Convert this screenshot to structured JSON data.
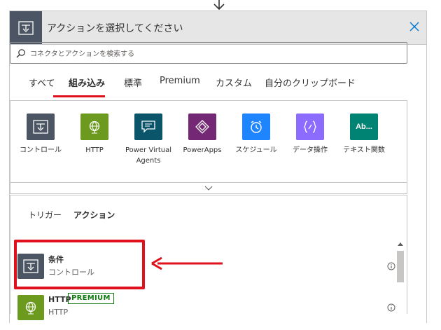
{
  "header": {
    "title": "アクションを選択してください"
  },
  "search": {
    "placeholder": "コネクタとアクションを検索する"
  },
  "tabs": [
    {
      "label": "すべて"
    },
    {
      "label": "組み込み"
    },
    {
      "label": "標準"
    },
    {
      "label": "Premium"
    },
    {
      "label": "カスタム"
    },
    {
      "label": "自分のクリップボード"
    }
  ],
  "active_tab": "組み込み",
  "connectors": [
    {
      "label": "コントロール",
      "icon": "control-icon",
      "color": "#4b5563"
    },
    {
      "label": "HTTP",
      "icon": "globe-icon",
      "color": "#6b9a1f"
    },
    {
      "label": "Power Virtual Agents",
      "icon": "chat-bot-icon",
      "color": "#0b556a"
    },
    {
      "label": "PowerApps",
      "icon": "powerapps-icon",
      "color": "#742774"
    },
    {
      "label": "スケジュール",
      "icon": "clock-icon",
      "color": "#1f85ff"
    },
    {
      "label": "データ操作",
      "icon": "data-operation-icon",
      "color": "#8c6cff"
    },
    {
      "label": "テキスト関数",
      "icon": "text-function-icon",
      "color": "#008372",
      "glyph": "Ab..."
    }
  ],
  "subtabs": [
    {
      "label": "トリガー"
    },
    {
      "label": "アクション"
    }
  ],
  "active_subtab": "アクション",
  "actions": [
    {
      "name": "条件",
      "connector": "コントロール",
      "icon": "control-icon",
      "color": "#4b5563"
    },
    {
      "name": "HTTP",
      "connector": "HTTP",
      "icon": "globe-icon",
      "color": "#6b9a1f",
      "badge": "PREMIUM"
    }
  ],
  "colors": {
    "highlight": "#e0101d",
    "premium": "#107c10",
    "header_bg": "#e6e6e6"
  }
}
